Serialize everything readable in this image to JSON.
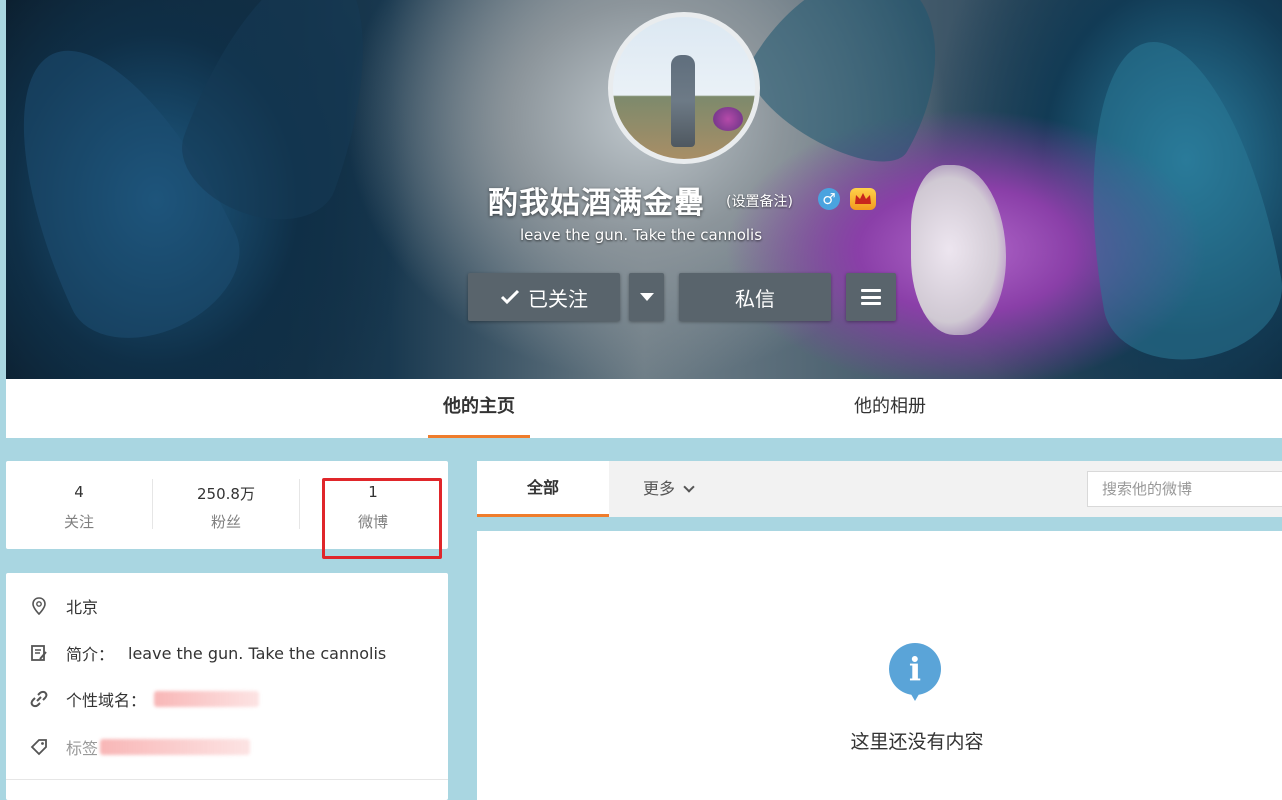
{
  "profile": {
    "name": "酌我姑酒满金罍",
    "remark": "(设置备注)",
    "gender_symbol": "♂",
    "vip_badge": "VIP",
    "bio": "leave the gun. Take the cannolis"
  },
  "actions": {
    "follow_label": "已关注",
    "message_label": "私信"
  },
  "tabs": {
    "home": "他的主页",
    "album": "他的相册"
  },
  "stats": [
    {
      "value": "4",
      "label": "关注"
    },
    {
      "value": "250.8万",
      "label": "粉丝"
    },
    {
      "value": "1",
      "label": "微博"
    }
  ],
  "info": {
    "location": "北京",
    "intro_label": "简介：",
    "intro_value": "leave the gun. Take the cannolis",
    "domain_label": "个性域名：",
    "tags_label": "标签"
  },
  "feed": {
    "tab_all": "全部",
    "tab_more": "更多",
    "search_placeholder": "搜索他的微博",
    "empty_message": "这里还没有内容"
  },
  "colors": {
    "accent": "#ef7d2c",
    "highlight_box": "#e0262a",
    "page_bg": "#a9d6e1",
    "button_bg": "#59646c",
    "info_icon": "#5aa4d8"
  },
  "icons": {
    "location": "location-pin-icon",
    "intro": "edit-note-icon",
    "domain": "link-icon",
    "tags": "tag-icon"
  }
}
